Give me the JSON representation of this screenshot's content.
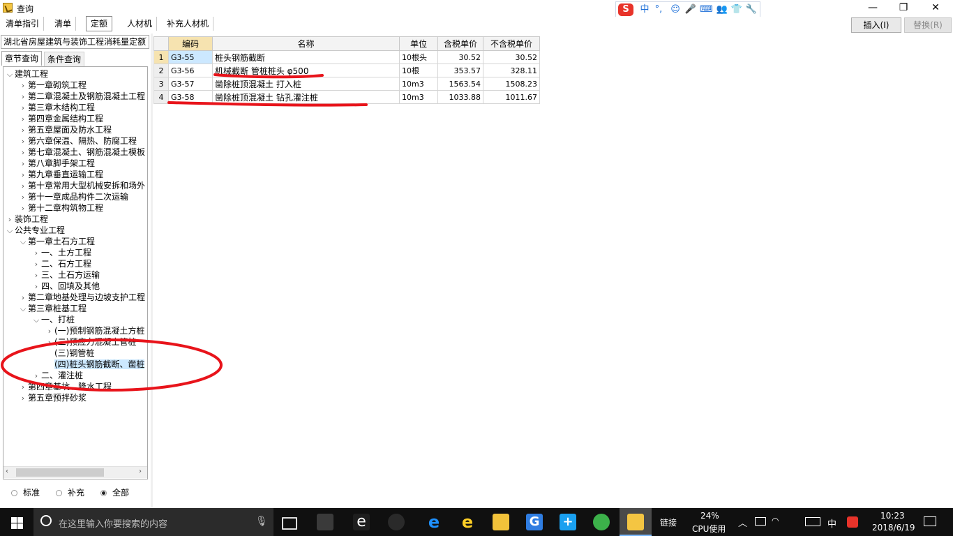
{
  "window": {
    "title": "查询",
    "minimize": "—",
    "maximize": "❐",
    "close": "✕"
  },
  "ime": {
    "logo": "S",
    "items": [
      "中",
      "°,",
      "☺",
      "🎤",
      "⌨",
      "👥",
      "👕",
      "🔧"
    ]
  },
  "tabs": [
    {
      "label": "清单指引",
      "active": false
    },
    {
      "label": "清单",
      "active": false
    },
    {
      "label": "定额",
      "active": true
    },
    {
      "label": "人材机",
      "active": false
    },
    {
      "label": "补充人材机",
      "active": false
    }
  ],
  "actions": {
    "insert": "插入(I)",
    "replace": "替换(R)"
  },
  "left": {
    "library": "湖北省房屋建筑与装饰工程消耗量定额",
    "subtabs": [
      "章节查询",
      "条件查询"
    ],
    "filters": [
      {
        "label": "标准",
        "checked": false
      },
      {
        "label": "补充",
        "checked": false
      },
      {
        "label": "全部",
        "checked": true
      }
    ]
  },
  "tree": [
    {
      "label": "建筑工程",
      "level": 0,
      "expander": "v"
    },
    {
      "label": "第一章砌筑工程",
      "level": 1,
      "expander": ">"
    },
    {
      "label": "第二章混凝土及钢筋混凝土工程",
      "level": 1,
      "expander": ">"
    },
    {
      "label": "第三章木结构工程",
      "level": 1,
      "expander": ">"
    },
    {
      "label": "第四章金属结构工程",
      "level": 1,
      "expander": ">"
    },
    {
      "label": "第五章屋面及防水工程",
      "level": 1,
      "expander": ">"
    },
    {
      "label": "第六章保温、隔热、防腐工程",
      "level": 1,
      "expander": ">"
    },
    {
      "label": "第七章混凝土、钢筋混凝土模板",
      "level": 1,
      "expander": ">"
    },
    {
      "label": "第八章脚手架工程",
      "level": 1,
      "expander": ">"
    },
    {
      "label": "第九章垂直运输工程",
      "level": 1,
      "expander": ">"
    },
    {
      "label": "第十章常用大型机械安拆和场外",
      "level": 1,
      "expander": ">"
    },
    {
      "label": "第十一章成品构件二次运输",
      "level": 1,
      "expander": ">"
    },
    {
      "label": "第十二章构筑物工程",
      "level": 1,
      "expander": ">"
    },
    {
      "label": "装饰工程",
      "level": 0,
      "expander": ">"
    },
    {
      "label": "公共专业工程",
      "level": 0,
      "expander": "v"
    },
    {
      "label": "第一章土石方工程",
      "level": 1,
      "expander": "v"
    },
    {
      "label": "一、土方工程",
      "level": 2,
      "expander": ">"
    },
    {
      "label": "二、石方工程",
      "level": 2,
      "expander": ">"
    },
    {
      "label": "三、土石方运输",
      "level": 2,
      "expander": ">"
    },
    {
      "label": "四、回填及其他",
      "level": 2,
      "expander": ">"
    },
    {
      "label": "第二章地基处理与边坡支护工程",
      "level": 1,
      "expander": ">"
    },
    {
      "label": "第三章桩基工程",
      "level": 1,
      "expander": "v"
    },
    {
      "label": "一、打桩",
      "level": 2,
      "expander": "v"
    },
    {
      "label": "(一)预制钢筋混凝土方桩",
      "level": 3,
      "expander": ">"
    },
    {
      "label": "(二)预应力混凝土管桩",
      "level": 3,
      "expander": ">"
    },
    {
      "label": "(三)钢管桩",
      "level": 3,
      "expander": ""
    },
    {
      "label": "(四)桩头钢筋截断、凿桩",
      "level": 3,
      "expander": "",
      "selected": true
    },
    {
      "label": "二、灌注桩",
      "level": 2,
      "expander": ">"
    },
    {
      "label": "第四章基坑、降水工程",
      "level": 1,
      "expander": ">"
    },
    {
      "label": "第五章预拌砂浆",
      "level": 1,
      "expander": ">"
    }
  ],
  "grid": {
    "headers": [
      "编码",
      "名称",
      "单位",
      "含税单价",
      "不含税单价"
    ],
    "rows": [
      {
        "no": "1",
        "code": "G3-55",
        "name": "桩头钢筋截断",
        "unit": "10根头",
        "tax_price": "30.52",
        "notax_price": "30.52"
      },
      {
        "no": "2",
        "code": "G3-56",
        "name": "机械截断 管桩桩头 φ500",
        "unit": "10根",
        "tax_price": "353.57",
        "notax_price": "328.11"
      },
      {
        "no": "3",
        "code": "G3-57",
        "name": "凿除桩顶混凝土 打入桩",
        "unit": "10m3",
        "tax_price": "1563.54",
        "notax_price": "1508.23"
      },
      {
        "no": "4",
        "code": "G3-58",
        "name": "凿除桩顶混凝土 钻孔灌注桩",
        "unit": "10m3",
        "tax_price": "1033.88",
        "notax_price": "1011.67"
      }
    ]
  },
  "annotation_color": "#e8141b",
  "taskbar": {
    "search_placeholder": "在这里输入你要搜索的内容",
    "link_label": "链接",
    "cpu_percent": "24%",
    "cpu_label": "CPU使用",
    "lang": "中",
    "time": "10:23",
    "date": "2018/6/19"
  }
}
